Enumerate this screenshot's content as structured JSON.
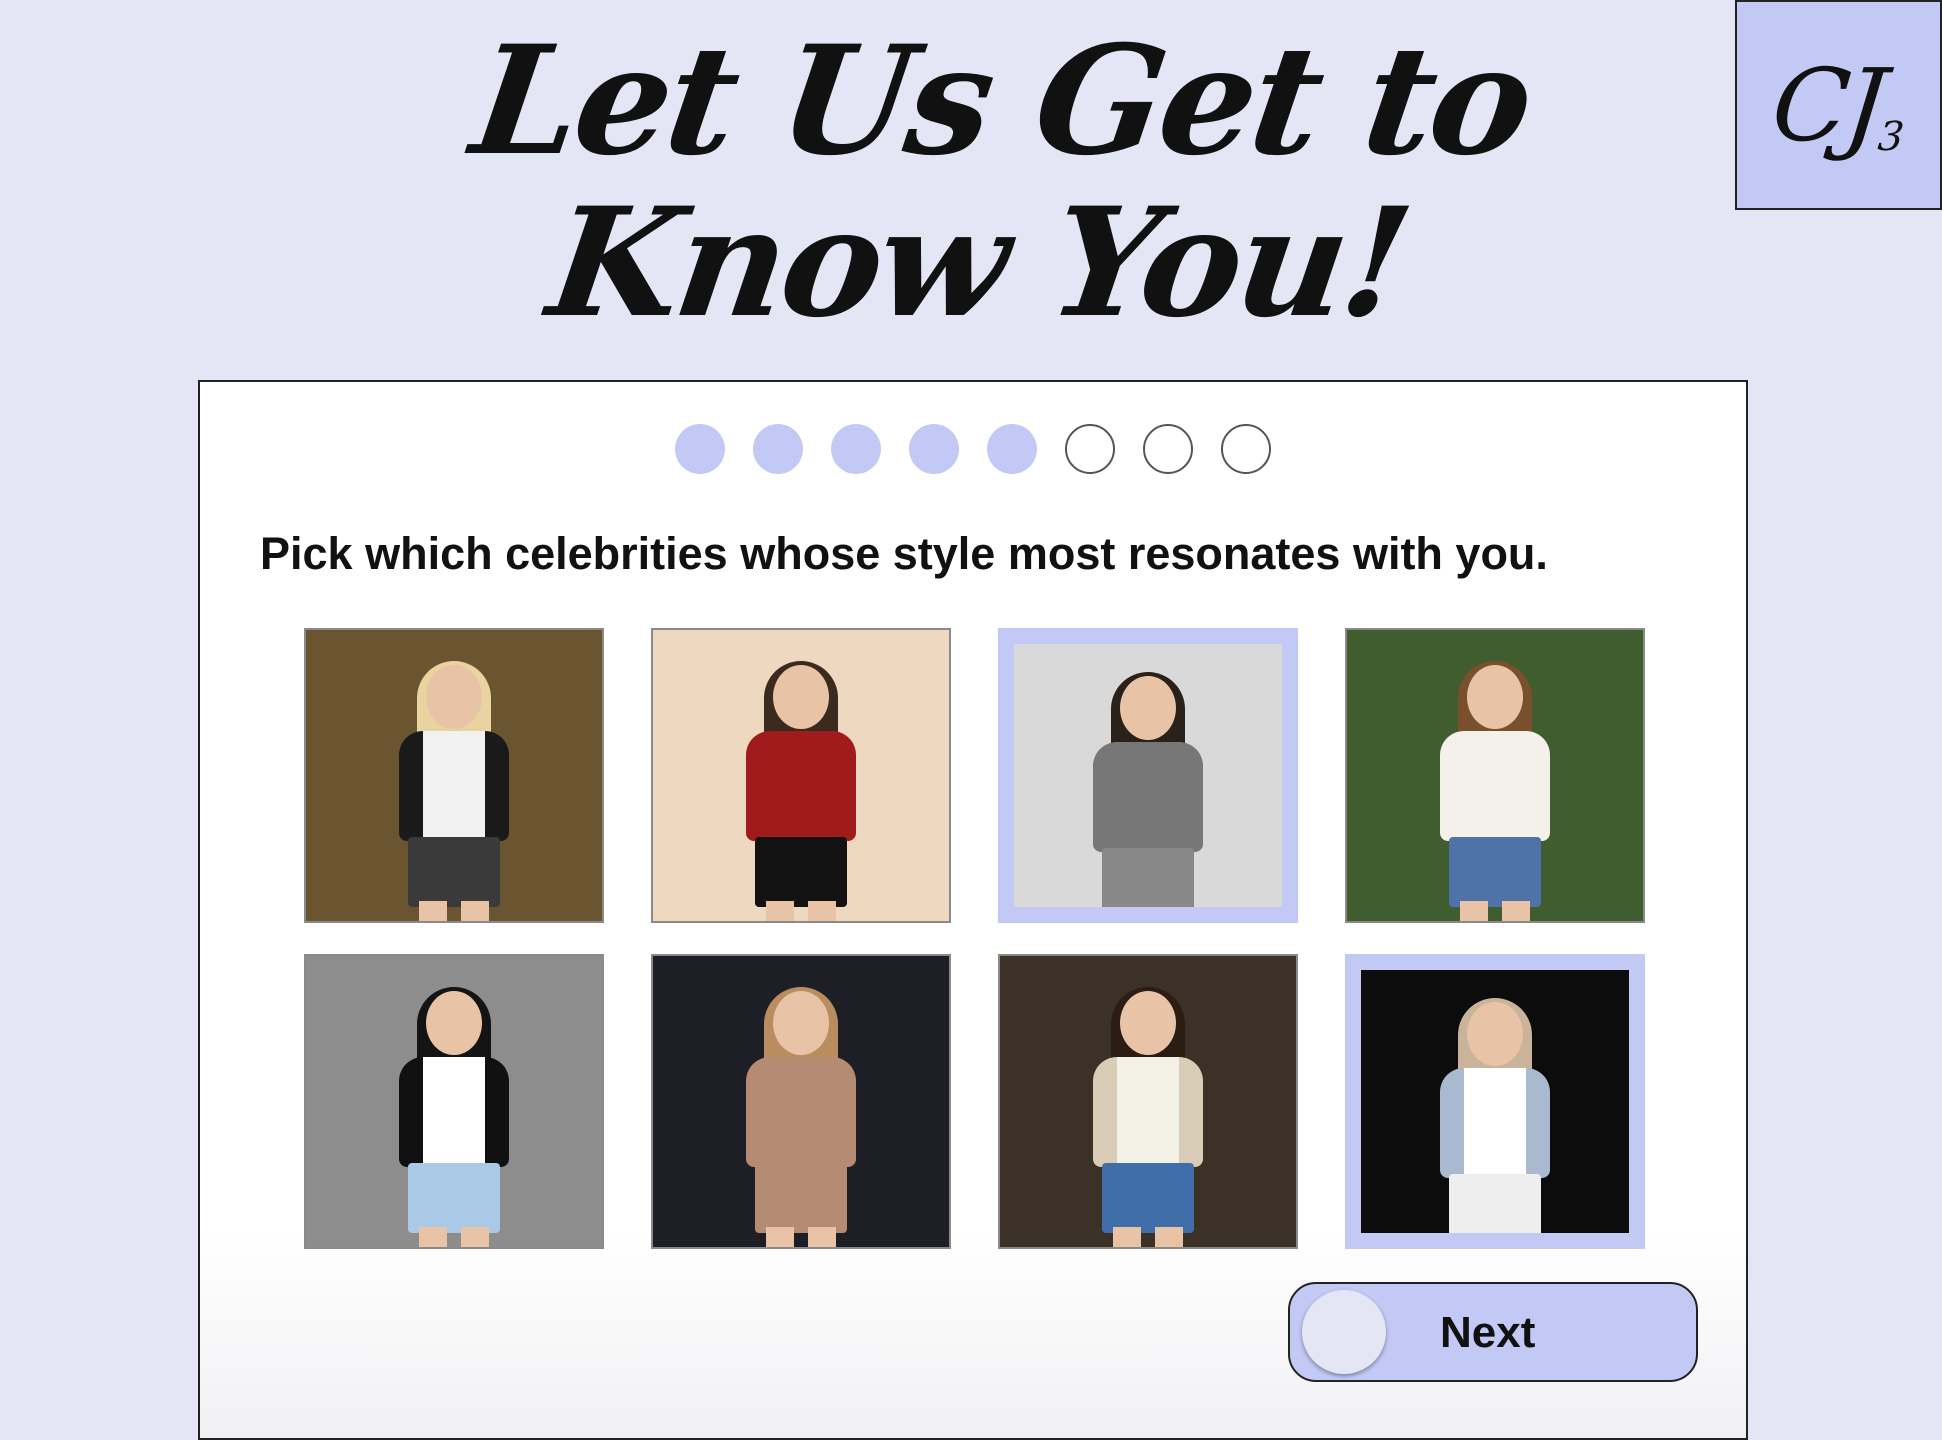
{
  "header": {
    "title": "Let Us Get to Know You!",
    "logo_text": "CJ",
    "logo_sub": "3"
  },
  "progress": {
    "total_steps": 8,
    "completed_steps": 5
  },
  "question": {
    "prompt": "Pick which celebrities whose style most resonates with you."
  },
  "options": [
    {
      "selected": false,
      "bg": "#6b5531",
      "hair": "#e9d3a0",
      "top": "#f2f2f2",
      "coat": "#1a1a1a",
      "lower": "#3a3a3a"
    },
    {
      "selected": false,
      "bg": "#eed9c0",
      "hair": "#3b2a1e",
      "top": "#a01b1b",
      "coat": "#a01b1b",
      "lower": "#121212"
    },
    {
      "selected": true,
      "bg": "#d9d9d9",
      "hair": "#2a211b",
      "top": "#777777",
      "coat": "#777777",
      "lower": "#888888"
    },
    {
      "selected": false,
      "bg": "#3f5d2e",
      "hair": "#7a4f2c",
      "top": "#f4f1ea",
      "coat": "#f4f1ea",
      "lower": "#4f73a8"
    },
    {
      "selected": false,
      "bg": "#8d8d8d",
      "hair": "#141414",
      "top": "#ffffff",
      "coat": "#111111",
      "lower": "#a9c9e6"
    },
    {
      "selected": false,
      "bg": "#1e1e26",
      "hair": "#b98d5e",
      "top": "#b58c73",
      "coat": "#b58c73",
      "lower": "#b58c73"
    },
    {
      "selected": false,
      "bg": "#3b3127",
      "hair": "#2b1d14",
      "top": "#f3f0e6",
      "coat": "#d9cdb8",
      "lower": "#3f6ea8"
    },
    {
      "selected": true,
      "bg": "#0c0c0c",
      "hair": "#c9b39a",
      "top": "#ffffff",
      "coat": "#a9b9cf",
      "lower": "#eeeeee"
    }
  ],
  "actions": {
    "next_label": "Next"
  },
  "colors": {
    "accent": "#c2c9f5",
    "background": "#e4e6f5"
  }
}
